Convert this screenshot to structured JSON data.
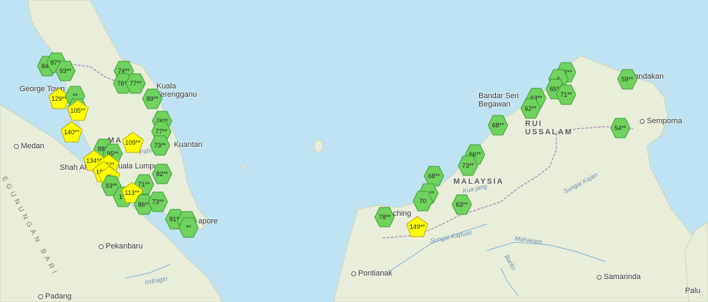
{
  "colors": {
    "sea": "#bfe3f2",
    "land": "#e9eedb",
    "green_marker": "#6fd35e",
    "yellow_marker": "#ffff00",
    "border": "#b58fc0",
    "river": "#7fb0d8"
  },
  "cities": [
    {
      "id": "george-town",
      "label": "George Town",
      "big": false,
      "dot": false
    },
    {
      "id": "kuala-terengganu",
      "label": "Kuala\nTerengganu",
      "big": false,
      "dot": false
    },
    {
      "id": "medan",
      "label": "Medan",
      "big": false,
      "dot": true
    },
    {
      "id": "kuantan",
      "label": "Kuantan",
      "big": false,
      "dot": false
    },
    {
      "id": "shah-alam",
      "label": "Shah Al",
      "big": false,
      "dot": false
    },
    {
      "id": "kuala-lumpur",
      "label": "uala Lumpur",
      "big": false,
      "dot": false
    },
    {
      "id": "singapore",
      "label": "apore",
      "big": false,
      "dot": false
    },
    {
      "id": "pekanbaru",
      "label": "Pekanbaru",
      "big": false,
      "dot": true
    },
    {
      "id": "padang",
      "label": "Padang",
      "big": false,
      "dot": true
    },
    {
      "id": "malaysia-west",
      "label": "MA  SI",
      "big": true,
      "dot": false
    },
    {
      "id": "bandar-seri-begawan",
      "label": "Bandar Seri\nBegawan",
      "big": false,
      "dot": false
    },
    {
      "id": "brunei",
      "label": "RUI\nUSSALAM",
      "big": true,
      "dot": false
    },
    {
      "id": "sandakan",
      "label": "andakan",
      "big": false,
      "dot": false
    },
    {
      "id": "semporna",
      "label": "Semporna",
      "big": false,
      "dot": true
    },
    {
      "id": "malaysia-east",
      "label": "MALAYSIA",
      "big": true,
      "dot": false
    },
    {
      "id": "kuching",
      "label": "ching",
      "big": false,
      "dot": false
    },
    {
      "id": "pontianak",
      "label": "Pontianak",
      "big": false,
      "dot": true
    },
    {
      "id": "samarinda",
      "label": "Samarinda",
      "big": false,
      "dot": true
    },
    {
      "id": "palu",
      "label": "Palu",
      "big": false,
      "dot": false
    }
  ],
  "rivers": [
    {
      "id": "indragiri",
      "label": "Indragiri"
    },
    {
      "id": "kapuas",
      "label": "Sungai Kapuas"
    },
    {
      "id": "kuantan-river",
      "label": "Kua  jang"
    },
    {
      "id": "mahakam",
      "label": "Mahakam"
    },
    {
      "id": "barito",
      "label": "Barito"
    },
    {
      "id": "kajan",
      "label": "Sungai Kajan"
    },
    {
      "id": "pahang",
      "label": "Paha"
    }
  ],
  "mountains": [
    {
      "id": "gunung-barisan",
      "label": "EGUNUNGAN BARI"
    }
  ],
  "markers": [
    {
      "value": "84**",
      "level": "good"
    },
    {
      "value": "87**",
      "level": "good"
    },
    {
      "value": "93**",
      "level": "good"
    },
    {
      "value": "129**",
      "level": "moderate"
    },
    {
      "value": "**",
      "level": "good"
    },
    {
      "value": "96**",
      "level": "good"
    },
    {
      "value": "105**",
      "level": "moderate"
    },
    {
      "value": "140**",
      "level": "moderate"
    },
    {
      "value": "74**",
      "level": "good"
    },
    {
      "value": "76**",
      "level": "good"
    },
    {
      "value": "77**",
      "level": "good"
    },
    {
      "value": "89**",
      "level": "good"
    },
    {
      "value": "76**",
      "level": "good"
    },
    {
      "value": "77**",
      "level": "good"
    },
    {
      "value": "73**",
      "level": "good"
    },
    {
      "value": "109**",
      "level": "moderate"
    },
    {
      "value": "88**",
      "level": "good"
    },
    {
      "value": "95**",
      "level": "good"
    },
    {
      "value": "134**",
      "level": "moderate"
    },
    {
      "value": "55**",
      "level": "moderate"
    },
    {
      "value": "192**",
      "level": "moderate"
    },
    {
      "value": "**",
      "level": "moderate"
    },
    {
      "value": "82**",
      "level": "good"
    },
    {
      "value": "93**",
      "level": "good"
    },
    {
      "value": "1**",
      "level": "good"
    },
    {
      "value": "71**",
      "level": "good"
    },
    {
      "value": "113**",
      "level": "moderate"
    },
    {
      "value": "86**",
      "level": "good"
    },
    {
      "value": "73**",
      "level": "good"
    },
    {
      "value": "81**",
      "level": "good"
    },
    {
      "value": "**",
      "level": "good"
    },
    {
      "value": "**",
      "level": "good"
    },
    {
      "value": "72**",
      "level": "good"
    },
    {
      "value": "6",
      "level": "good"
    },
    {
      "value": "65**",
      "level": "good"
    },
    {
      "value": "71**",
      "level": "good"
    },
    {
      "value": "59**",
      "level": "good"
    },
    {
      "value": "63**",
      "level": "good"
    },
    {
      "value": "62**",
      "level": "good"
    },
    {
      "value": "68**",
      "level": "good"
    },
    {
      "value": "54**",
      "level": "good"
    },
    {
      "value": "66**",
      "level": "good"
    },
    {
      "value": "73**",
      "level": "good"
    },
    {
      "value": "68**",
      "level": "good"
    },
    {
      "value": "71**",
      "level": "good"
    },
    {
      "value": "70",
      "level": "good"
    },
    {
      "value": "63**",
      "level": "good"
    },
    {
      "value": "78**",
      "level": "good"
    },
    {
      "value": "149**",
      "level": "moderate"
    }
  ]
}
